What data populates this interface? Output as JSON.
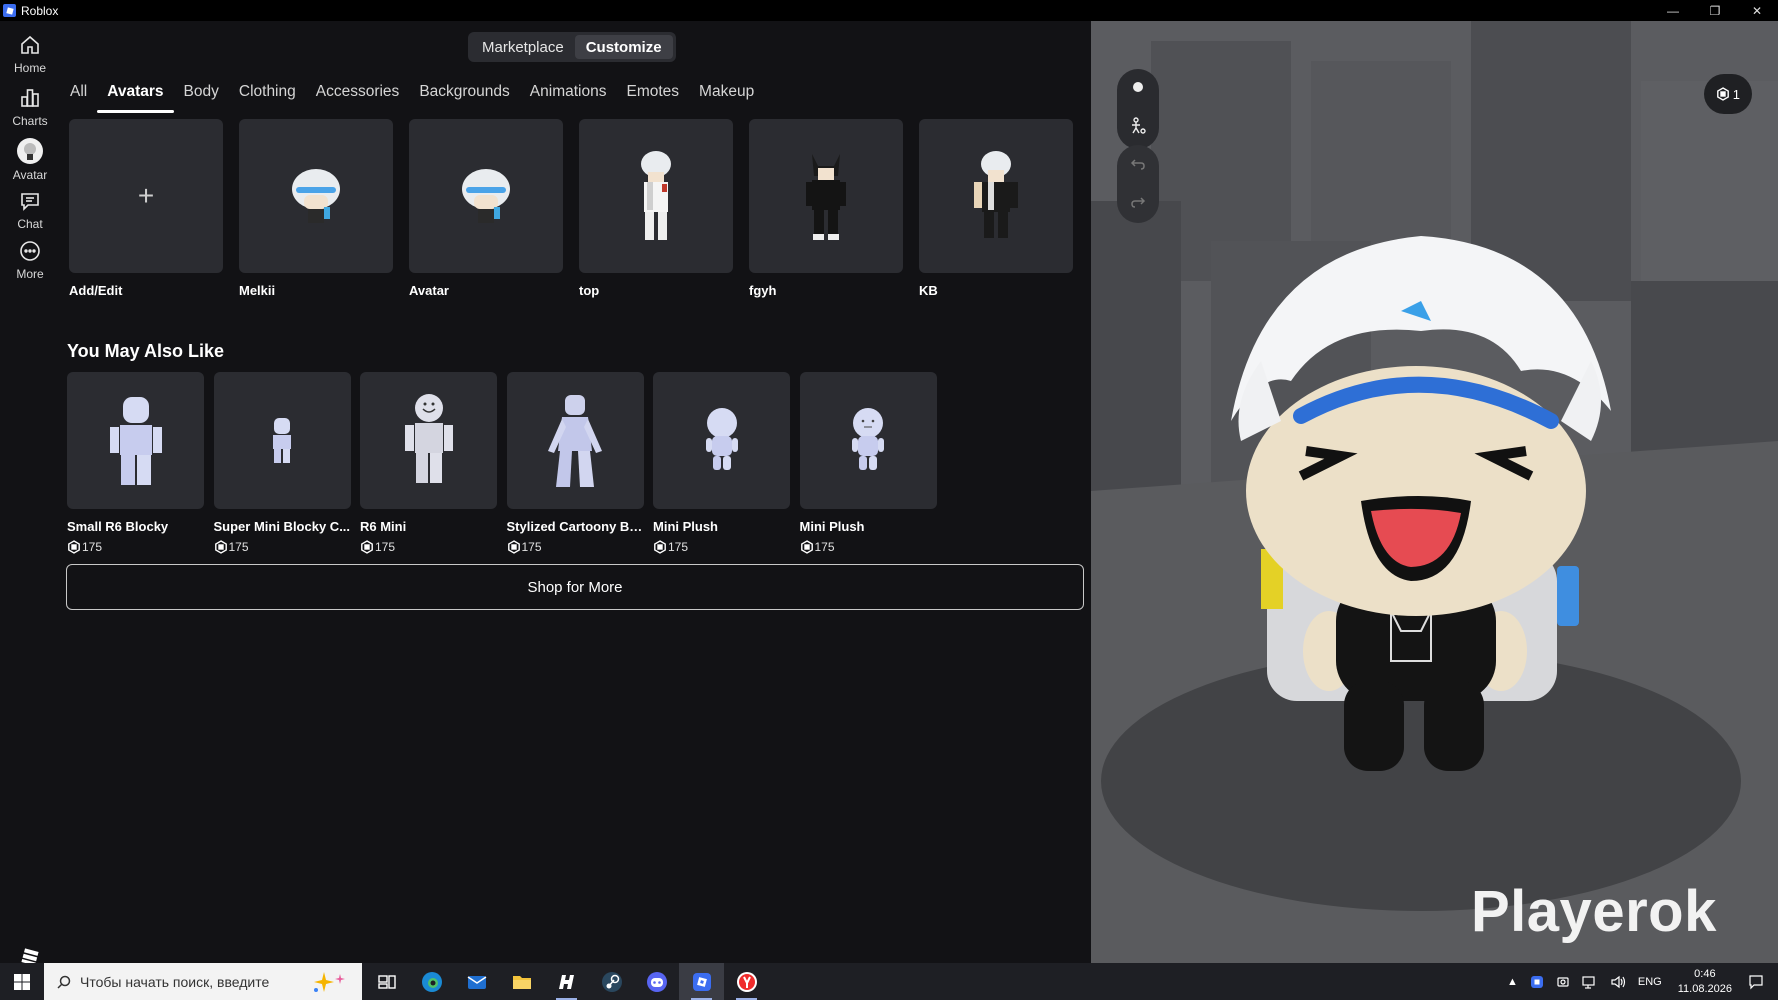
{
  "window": {
    "title": "Roblox",
    "controls": [
      "—",
      "❐",
      "✕"
    ]
  },
  "nav": {
    "items": [
      {
        "label": "Home"
      },
      {
        "label": "Charts"
      },
      {
        "label": "Avatar"
      },
      {
        "label": "Chat"
      },
      {
        "label": "More"
      }
    ]
  },
  "header": {
    "segments": [
      "Marketplace",
      "Customize"
    ],
    "active_segment": "Customize"
  },
  "tabs": [
    "All",
    "Avatars",
    "Body",
    "Clothing",
    "Accessories",
    "Backgrounds",
    "Animations",
    "Emotes",
    "Makeup"
  ],
  "active_tab": "Avatars",
  "avatars": [
    {
      "name": "Add/Edit",
      "icon": "plus-icon"
    },
    {
      "name": "Melkii"
    },
    {
      "name": "Avatar"
    },
    {
      "name": "top"
    },
    {
      "name": "fgyh"
    },
    {
      "name": "KB"
    }
  ],
  "recommend": {
    "title": "You May Also Like",
    "items": [
      {
        "name": "Small R6 Blocky",
        "price": "175"
      },
      {
        "name": "Super Mini Blocky C...",
        "price": "175"
      },
      {
        "name": "R6 Mini",
        "price": "175"
      },
      {
        "name": "Stylized Cartoony Bl...",
        "price": "175"
      },
      {
        "name": "Mini Plush",
        "price": "175"
      },
      {
        "name": "Mini Plush",
        "price": "175"
      }
    ],
    "shop_more": "Shop for More"
  },
  "viewport": {
    "robux": "1",
    "player_name": "Playerok"
  },
  "taskbar": {
    "search_placeholder": "Чтобы начать поиск, введите",
    "lang": "ENG",
    "time": "0:46",
    "date": "11.08.2026"
  },
  "colors": {
    "bg": "#121215",
    "card": "#2b2c31",
    "accent_blue": "#3b6df0"
  }
}
